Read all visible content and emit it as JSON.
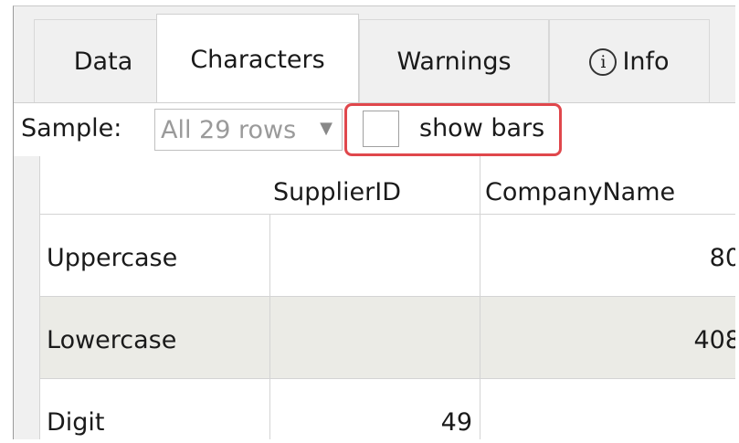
{
  "tabs": [
    {
      "label": "Data"
    },
    {
      "label": "Characters"
    },
    {
      "label": "Warnings"
    },
    {
      "label": "Info"
    }
  ],
  "toolbar": {
    "sample_label": "Sample:",
    "sample_value": "All 29 rows",
    "show_bars_label": "show bars",
    "show_bars_checked": false
  },
  "table": {
    "columns": [
      "",
      "SupplierID",
      "CompanyName"
    ],
    "rows": [
      {
        "label": "Uppercase",
        "supplier_id": "",
        "company_name": "80"
      },
      {
        "label": "Lowercase",
        "supplier_id": "",
        "company_name": "408"
      },
      {
        "label": "Digit",
        "supplier_id": "49",
        "company_name": ""
      }
    ]
  },
  "colors": {
    "highlight": "#e0474c",
    "alt_row": "#ebebe6"
  }
}
